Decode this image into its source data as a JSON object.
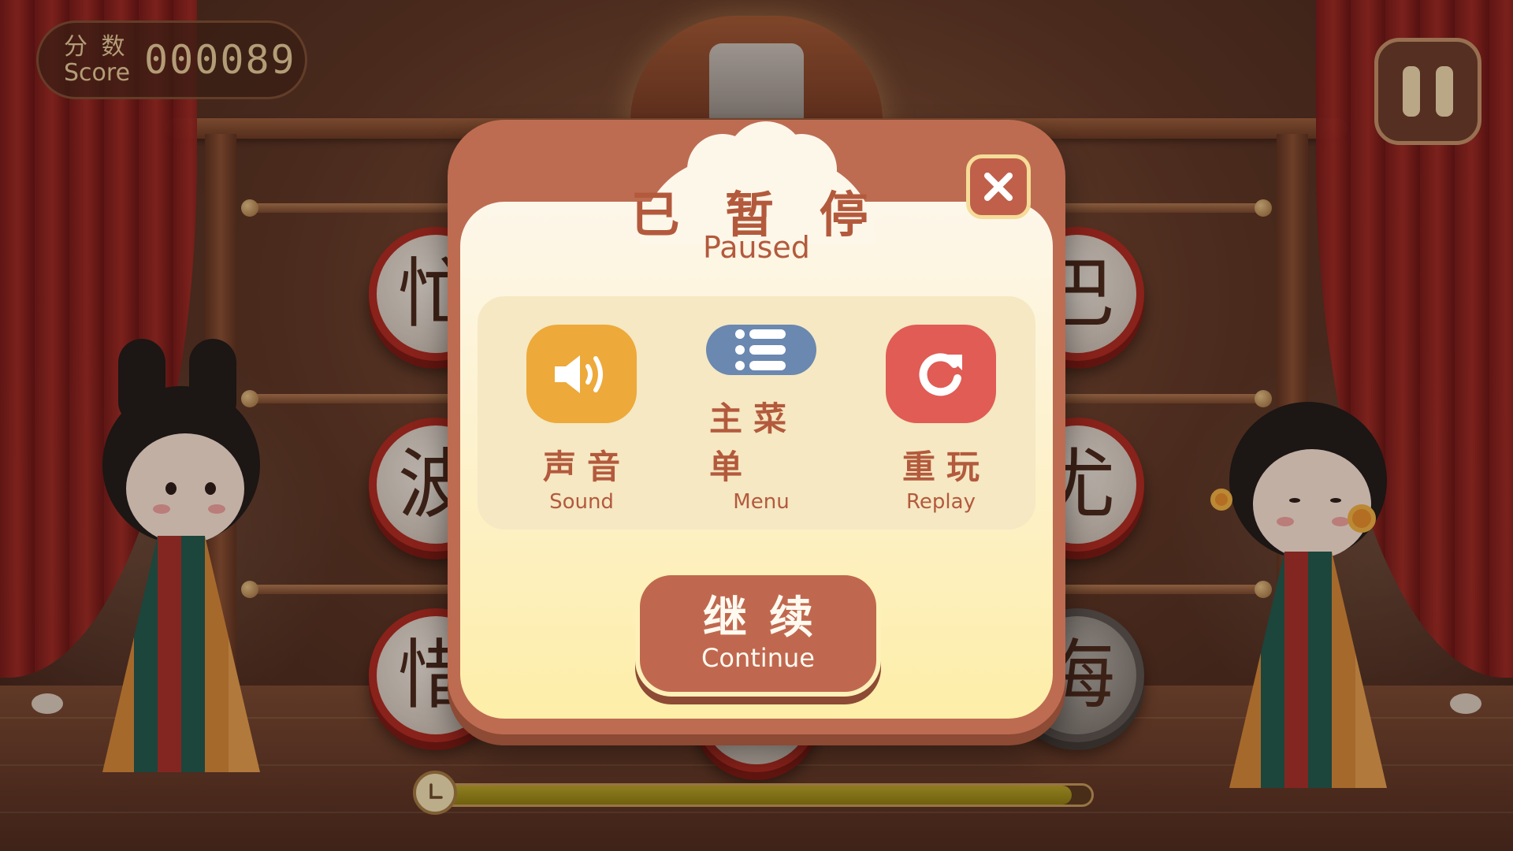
{
  "hud": {
    "score_label_cn": "分 数",
    "score_label_en": "Score",
    "score_value": "000089",
    "timer_progress": 0.97
  },
  "drums": {
    "left": [
      "忙",
      "波",
      "惜"
    ],
    "right": [
      "巴",
      "尤",
      "海"
    ]
  },
  "pause_dialog": {
    "title_cn": "已 暂 停",
    "title_en": "Paused",
    "options": [
      {
        "label_cn": "声音",
        "label_en": "Sound",
        "icon": "speaker-icon",
        "color": "#EDA93A"
      },
      {
        "label_cn": "主菜单",
        "label_en": "Menu",
        "icon": "list-icon",
        "color": "#6A88B0"
      },
      {
        "label_cn": "重玩",
        "label_en": "Replay",
        "icon": "replay-icon",
        "color": "#E05C55"
      }
    ],
    "continue_cn": "继续",
    "continue_en": "Continue"
  },
  "colors": {
    "dialog_frame": "#BD6C52",
    "dialog_text": "#B35A3D",
    "timer_fill": "#B8A52A"
  }
}
